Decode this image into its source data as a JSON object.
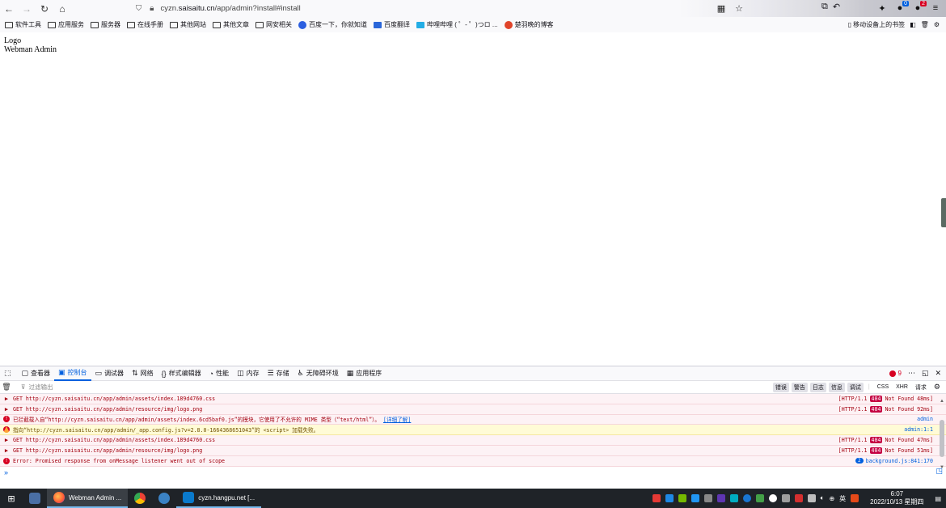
{
  "browser": {
    "url_prefix": "cyzn.",
    "url_host": "saisaitu.cn",
    "url_path": "/app/admin?install#install",
    "badge_counts": [
      "0",
      "2"
    ]
  },
  "bookmarks": [
    {
      "label": "软件工具",
      "icon": "folder-icon"
    },
    {
      "label": "应用服务",
      "icon": "folder-icon"
    },
    {
      "label": "服务器",
      "icon": "folder-icon"
    },
    {
      "label": "在线手册",
      "icon": "folder-icon"
    },
    {
      "label": "其他网站",
      "icon": "folder-icon"
    },
    {
      "label": "其他文章",
      "icon": "folder-icon"
    },
    {
      "label": "网安相关",
      "icon": "folder-icon"
    },
    {
      "label": "百度一下，你就知道",
      "icon": "paw-icon"
    },
    {
      "label": "百度翻译",
      "icon": "translate-icon"
    },
    {
      "label": "哔哩哔哩 ( ゜- ゜)つロ ...",
      "icon": "bilibili-icon"
    },
    {
      "label": "楚羽晚的博客",
      "icon": "blog-icon"
    }
  ],
  "bookmarks_right": {
    "mobile": "移动设备上的书签"
  },
  "page": {
    "logo_text": "Logo",
    "title": "Webman Admin"
  },
  "devtools": {
    "tabs": [
      {
        "label": "查看器",
        "icon": "inspector-icon",
        "active": false
      },
      {
        "label": "控制台",
        "icon": "console-icon",
        "active": true
      },
      {
        "label": "调试器",
        "icon": "debugger-icon",
        "active": false
      },
      {
        "label": "网络",
        "icon": "network-icon",
        "active": false
      },
      {
        "label": "样式编辑器",
        "icon": "style-editor-icon",
        "active": false
      },
      {
        "label": "性能",
        "icon": "performance-icon",
        "active": false
      },
      {
        "label": "内存",
        "icon": "memory-icon",
        "active": false
      },
      {
        "label": "存储",
        "icon": "storage-icon",
        "active": false
      },
      {
        "label": "无障碍环境",
        "icon": "accessibility-icon",
        "active": false
      },
      {
        "label": "应用程序",
        "icon": "application-icon",
        "active": false
      }
    ],
    "error_count": "9",
    "filter_placeholder": "过滤输出",
    "filter_buttons": [
      "错误",
      "警告",
      "日志",
      "信息",
      "调试"
    ],
    "filter_extra": [
      "CSS",
      "XHR",
      "请求"
    ],
    "logs": [
      {
        "type": "error",
        "kind": "net",
        "msg": "GET http://cyzn.saisaitu.cn/app/admin/assets/index.189d4760.css",
        "proto": "[HTTP/1.1",
        "status": "404",
        "status_text": "Not Found 48ms]"
      },
      {
        "type": "error",
        "kind": "net",
        "msg": "GET http://cyzn.saisaitu.cn/app/admin/resource/img/logo.png",
        "proto": "[HTTP/1.1",
        "status": "404",
        "status_text": "Not Found 92ms]"
      },
      {
        "type": "error",
        "kind": "mime",
        "msg": "已拦截载入自“http://cyzn.saisaitu.cn/app/admin/assets/index.6cd5baf0.js”的模块，它使用了不允许的 MIME 类型（“text/html”）。",
        "link": "[详细了解]",
        "src": "admin"
      },
      {
        "type": "warn",
        "kind": "script",
        "msg": "指向“http://cyzn.saisaitu.cn/app/admin/_app.config.js?v=2.8.0-1664368651043”的 <script> 加载失败。",
        "src": "admin:1:1"
      },
      {
        "type": "error",
        "kind": "net",
        "msg": "GET http://cyzn.saisaitu.cn/app/admin/assets/index.189d4760.css",
        "proto": "[HTTP/1.1",
        "status": "404",
        "status_text": "Not Found 47ms]"
      },
      {
        "type": "error",
        "kind": "net",
        "msg": "GET http://cyzn.saisaitu.cn/app/admin/resource/img/logo.png",
        "proto": "[HTTP/1.1",
        "status": "404",
        "status_text": "Not Found 51ms]"
      },
      {
        "type": "error",
        "kind": "uncaught",
        "msg": "Error: Promised response from onMessage listener went out of scope",
        "count": "2",
        "src": "background.js:841:170"
      }
    ]
  },
  "taskbar": {
    "items": [
      {
        "label": "",
        "icon": "calculator-icon"
      },
      {
        "label": "Webman Admin ...",
        "icon": "firefox-icon",
        "active": true
      },
      {
        "label": "",
        "icon": "chrome-icon"
      },
      {
        "label": "",
        "icon": "app-s-icon"
      },
      {
        "label": "cyzn.hangpu.net [...",
        "icon": "vscode-icon",
        "open": true
      }
    ],
    "ime": "英",
    "time": "6:07",
    "date": "2022/10/13 星期四"
  },
  "colors": {
    "accent": "#0060df",
    "error": "#d70022",
    "taskbar": "#1f2328"
  }
}
